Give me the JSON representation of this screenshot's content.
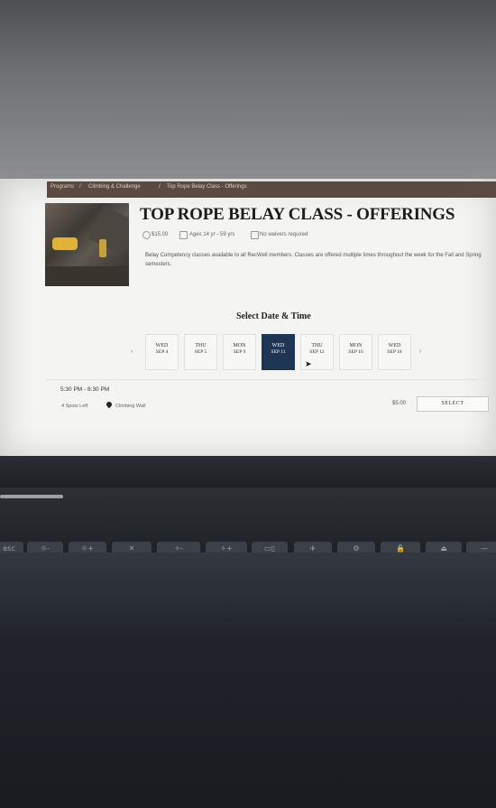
{
  "breadcrumb": {
    "items": [
      "Programs",
      "Climbing & Challenge",
      "Top Rope Belay Class - Offerings"
    ],
    "separator": "/"
  },
  "page": {
    "title": "TOP ROPE BELAY CLASS - OFFERINGS",
    "meta": {
      "price": "$15.00",
      "ages": "Ages 14 yr - 59 yrs",
      "waiver": "No waivers required"
    },
    "description": "Belay Competency classes available to all RecWell members. Classes are offered multiple times throughout the week for the Fall and Spring semesters."
  },
  "schedule": {
    "heading": "Select Date & Time",
    "prev_arrow": "‹",
    "next_arrow": "›",
    "dates": [
      {
        "dow": "WED",
        "date": "SEP 4",
        "selected": false
      },
      {
        "dow": "THU",
        "date": "SEP 5",
        "selected": false
      },
      {
        "dow": "MON",
        "date": "SEP 9",
        "selected": false
      },
      {
        "dow": "WED",
        "date": "SEP 11",
        "selected": true
      },
      {
        "dow": "THU",
        "date": "SEP 12",
        "selected": false
      },
      {
        "dow": "MON",
        "date": "SEP 16",
        "selected": false
      },
      {
        "dow": "WED",
        "date": "SEP 18",
        "selected": false
      }
    ]
  },
  "offering": {
    "time": "5:30 PM - 8:30 PM",
    "spots": "4 Spots Left",
    "location": "Climbing Wall",
    "price": "$5.00",
    "select_label": "SELECT"
  },
  "keyboard": {
    "keys": [
      "esc",
      "☼-",
      "☼+",
      "✕",
      "✧-",
      "✧+",
      "▭▯",
      "✈",
      "⚙",
      "🔒",
      "⏏",
      "—"
    ]
  },
  "colors": {
    "breadcrumb_bg": "#5a4a3f",
    "selected_date_bg": "#1e3554"
  }
}
